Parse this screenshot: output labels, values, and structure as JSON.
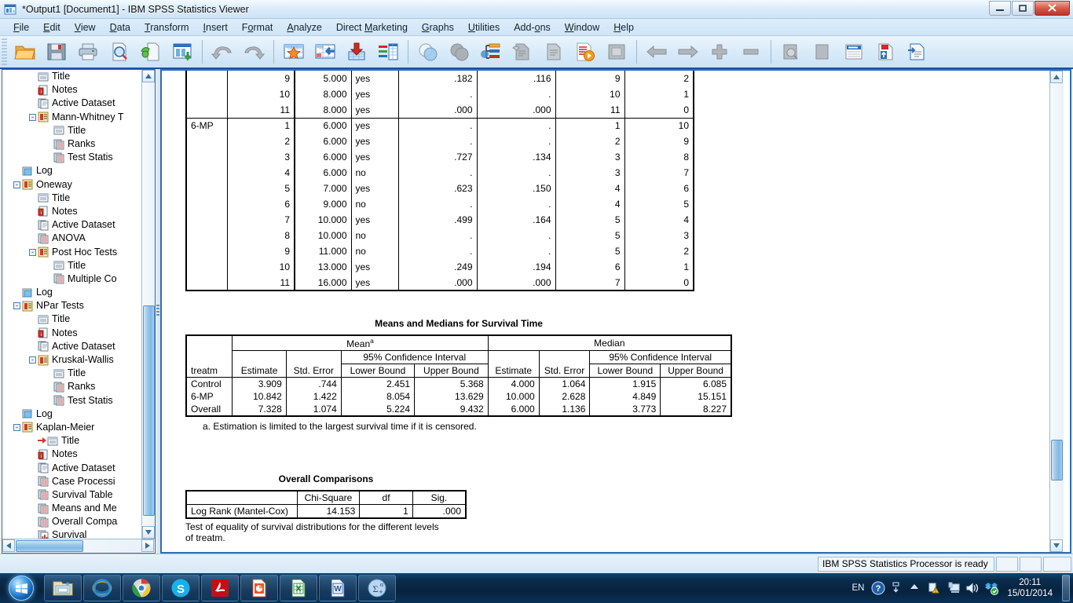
{
  "window": {
    "title": "*Output1 [Document1] - IBM SPSS Statistics Viewer",
    "minimize_label": "–",
    "maximize_label": "□",
    "close_label": "✕"
  },
  "menubar": {
    "items": [
      {
        "label": "File",
        "accel": "F"
      },
      {
        "label": "Edit",
        "accel": "E"
      },
      {
        "label": "View",
        "accel": "V"
      },
      {
        "label": "Data",
        "accel": "D"
      },
      {
        "label": "Transform",
        "accel": "T"
      },
      {
        "label": "Insert",
        "accel": "I"
      },
      {
        "label": "Format",
        "accel": "o"
      },
      {
        "label": "Analyze",
        "accel": "A"
      },
      {
        "label": "Direct Marketing",
        "accel": "M"
      },
      {
        "label": "Graphs",
        "accel": "G"
      },
      {
        "label": "Utilities",
        "accel": "U"
      },
      {
        "label": "Add-ons",
        "accel": "o"
      },
      {
        "label": "Window",
        "accel": "W"
      },
      {
        "label": "Help",
        "accel": "H"
      }
    ]
  },
  "toolbar": {
    "buttons": [
      {
        "name": "open-file-icon",
        "tooltip": "Open"
      },
      {
        "name": "save-icon",
        "tooltip": "Save"
      },
      {
        "name": "print-icon",
        "tooltip": "Print"
      },
      {
        "name": "print-preview-icon",
        "tooltip": "Print Preview"
      },
      {
        "name": "export-icon",
        "tooltip": "Export"
      },
      {
        "name": "dialog-recall-icon",
        "tooltip": "Recall recently used dialogs"
      },
      {
        "name": "undo-icon",
        "tooltip": "Undo"
      },
      {
        "name": "redo-icon",
        "tooltip": "Redo"
      },
      {
        "name": "goto-data-icon",
        "tooltip": "Go to data"
      },
      {
        "name": "goto-case-icon",
        "tooltip": "Go to case"
      },
      {
        "name": "insert-variable-icon",
        "tooltip": "Insert variable"
      },
      {
        "name": "split-file-icon",
        "tooltip": "Split file"
      },
      {
        "name": "weight-cases-icon",
        "tooltip": "Weight cases"
      },
      {
        "name": "select-cases-icon",
        "tooltip": "Select cases"
      },
      {
        "name": "value-labels-icon",
        "tooltip": "Value labels"
      },
      {
        "name": "use-variable-sets-icon",
        "tooltip": "Use variable sets"
      },
      {
        "name": "show-all-variables-icon",
        "tooltip": "Show all variables"
      },
      {
        "name": "spell-check-icon",
        "tooltip": "Spell check"
      },
      {
        "name": "run-icon",
        "tooltip": "Run"
      },
      {
        "name": "overlay-icon",
        "tooltip": "Overlay"
      },
      {
        "name": "previous-output-icon",
        "tooltip": "Previous output"
      },
      {
        "name": "next-output-icon",
        "tooltip": "Next output"
      },
      {
        "name": "promote-icon",
        "tooltip": "Promote"
      },
      {
        "name": "demote-icon",
        "tooltip": "Demote"
      },
      {
        "name": "preview-icon",
        "tooltip": "Preview"
      },
      {
        "name": "hide-icon",
        "tooltip": "Hide"
      },
      {
        "name": "insert-heading-icon",
        "tooltip": "Insert heading"
      },
      {
        "name": "insert-title-icon",
        "tooltip": "Insert title"
      },
      {
        "name": "insert-text-icon",
        "tooltip": "Insert text"
      }
    ]
  },
  "outline": {
    "items": [
      {
        "label": "Title",
        "icon": "title-icon",
        "depth": 3,
        "expander": ""
      },
      {
        "label": "Notes",
        "icon": "notes-icon",
        "depth": 3,
        "expander": ""
      },
      {
        "label": "Active Dataset",
        "icon": "dataset-icon",
        "depth": 3,
        "expander": ""
      },
      {
        "label": "Mann-Whitney T",
        "icon": "output-icon",
        "depth": 3,
        "expander": "-"
      },
      {
        "label": "Title",
        "icon": "title-icon",
        "depth": 4,
        "expander": ""
      },
      {
        "label": "Ranks",
        "icon": "table-icon",
        "depth": 4,
        "expander": ""
      },
      {
        "label": "Test Statis",
        "icon": "table-icon",
        "depth": 4,
        "expander": ""
      },
      {
        "label": "Log",
        "icon": "log-icon",
        "depth": 2,
        "expander": ""
      },
      {
        "label": "Oneway",
        "icon": "output-icon",
        "depth": 2,
        "expander": "-"
      },
      {
        "label": "Title",
        "icon": "title-icon",
        "depth": 3,
        "expander": ""
      },
      {
        "label": "Notes",
        "icon": "notes-icon",
        "depth": 3,
        "expander": ""
      },
      {
        "label": "Active Dataset",
        "icon": "dataset-icon",
        "depth": 3,
        "expander": ""
      },
      {
        "label": "ANOVA",
        "icon": "table-icon",
        "depth": 3,
        "expander": ""
      },
      {
        "label": "Post Hoc Tests",
        "icon": "output-icon",
        "depth": 3,
        "expander": "-"
      },
      {
        "label": "Title",
        "icon": "title-icon",
        "depth": 4,
        "expander": ""
      },
      {
        "label": "Multiple Co",
        "icon": "table-icon",
        "depth": 4,
        "expander": ""
      },
      {
        "label": "Log",
        "icon": "log-icon",
        "depth": 2,
        "expander": ""
      },
      {
        "label": "NPar Tests",
        "icon": "output-icon",
        "depth": 2,
        "expander": "-"
      },
      {
        "label": "Title",
        "icon": "title-icon",
        "depth": 3,
        "expander": ""
      },
      {
        "label": "Notes",
        "icon": "notes-icon",
        "depth": 3,
        "expander": ""
      },
      {
        "label": "Active Dataset",
        "icon": "dataset-icon",
        "depth": 3,
        "expander": ""
      },
      {
        "label": "Kruskal-Wallis",
        "icon": "output-icon",
        "depth": 3,
        "expander": "-"
      },
      {
        "label": "Title",
        "icon": "title-icon",
        "depth": 4,
        "expander": ""
      },
      {
        "label": "Ranks",
        "icon": "table-icon",
        "depth": 4,
        "expander": ""
      },
      {
        "label": "Test Statis",
        "icon": "table-icon",
        "depth": 4,
        "expander": ""
      },
      {
        "label": "Log",
        "icon": "log-icon",
        "depth": 2,
        "expander": ""
      },
      {
        "label": "Kaplan-Meier",
        "icon": "output-icon",
        "depth": 2,
        "expander": "-"
      },
      {
        "label": "Title",
        "icon": "title-icon",
        "depth": 3,
        "expander": "",
        "selected": true
      },
      {
        "label": "Notes",
        "icon": "notes-icon",
        "depth": 3,
        "expander": ""
      },
      {
        "label": "Active Dataset",
        "icon": "dataset-icon",
        "depth": 3,
        "expander": ""
      },
      {
        "label": "Case Processi",
        "icon": "table-icon",
        "depth": 3,
        "expander": ""
      },
      {
        "label": "Survival Table",
        "icon": "table-icon",
        "depth": 3,
        "expander": ""
      },
      {
        "label": "Means and Me",
        "icon": "table-icon",
        "depth": 3,
        "expander": ""
      },
      {
        "label": "Overall Compa",
        "icon": "table-icon",
        "depth": 3,
        "expander": ""
      },
      {
        "label": "Survival",
        "icon": "chart-icon",
        "depth": 3,
        "expander": ""
      }
    ]
  },
  "output": {
    "survival_table": {
      "rows": [
        {
          "group": "",
          "n": "9",
          "time": "5.000",
          "status": "yes",
          "surv": ".182",
          "se": ".116",
          "cum_events": "9",
          "n_remaining": "2"
        },
        {
          "group": "",
          "n": "10",
          "time": "8.000",
          "status": "yes",
          "surv": ".",
          "se": ".",
          "cum_events": "10",
          "n_remaining": "1"
        },
        {
          "group": "",
          "n": "11",
          "time": "8.000",
          "status": "yes",
          "surv": ".000",
          "se": ".000",
          "cum_events": "11",
          "n_remaining": "0"
        },
        {
          "group": "6-MP",
          "n": "1",
          "time": "6.000",
          "status": "yes",
          "surv": ".",
          "se": ".",
          "cum_events": "1",
          "n_remaining": "10",
          "group_start": true
        },
        {
          "group": "",
          "n": "2",
          "time": "6.000",
          "status": "yes",
          "surv": ".",
          "se": ".",
          "cum_events": "2",
          "n_remaining": "9"
        },
        {
          "group": "",
          "n": "3",
          "time": "6.000",
          "status": "yes",
          "surv": ".727",
          "se": ".134",
          "cum_events": "3",
          "n_remaining": "8"
        },
        {
          "group": "",
          "n": "4",
          "time": "6.000",
          "status": "no",
          "surv": ".",
          "se": ".",
          "cum_events": "3",
          "n_remaining": "7"
        },
        {
          "group": "",
          "n": "5",
          "time": "7.000",
          "status": "yes",
          "surv": ".623",
          "se": ".150",
          "cum_events": "4",
          "n_remaining": "6"
        },
        {
          "group": "",
          "n": "6",
          "time": "9.000",
          "status": "no",
          "surv": ".",
          "se": ".",
          "cum_events": "4",
          "n_remaining": "5"
        },
        {
          "group": "",
          "n": "7",
          "time": "10.000",
          "status": "yes",
          "surv": ".499",
          "se": ".164",
          "cum_events": "5",
          "n_remaining": "4"
        },
        {
          "group": "",
          "n": "8",
          "time": "10.000",
          "status": "no",
          "surv": ".",
          "se": ".",
          "cum_events": "5",
          "n_remaining": "3"
        },
        {
          "group": "",
          "n": "9",
          "time": "11.000",
          "status": "no",
          "surv": ".",
          "se": ".",
          "cum_events": "5",
          "n_remaining": "2"
        },
        {
          "group": "",
          "n": "10",
          "time": "13.000",
          "status": "yes",
          "surv": ".249",
          "se": ".194",
          "cum_events": "6",
          "n_remaining": "1"
        },
        {
          "group": "",
          "n": "11",
          "time": "16.000",
          "status": "yes",
          "surv": ".000",
          "se": ".000",
          "cum_events": "7",
          "n_remaining": "0"
        }
      ]
    },
    "means_medians": {
      "title": "Means and Medians for Survival Time",
      "header_mean": "Mean",
      "header_mean_sup": "a",
      "header_median": "Median",
      "header_ci": "95% Confidence Interval",
      "col_rowlabel": "treatm",
      "col_estimate": "Estimate",
      "col_stderr": "Std. Error",
      "col_lower": "Lower Bound",
      "col_upper": "Upper Bound",
      "rows": [
        {
          "label": "Control",
          "mean_est": "3.909",
          "mean_se": ".744",
          "mean_lo": "2.451",
          "mean_hi": "5.368",
          "med_est": "4.000",
          "med_se": "1.064",
          "med_lo": "1.915",
          "med_hi": "6.085"
        },
        {
          "label": "6-MP",
          "mean_est": "10.842",
          "mean_se": "1.422",
          "mean_lo": "8.054",
          "mean_hi": "13.629",
          "med_est": "10.000",
          "med_se": "2.628",
          "med_lo": "4.849",
          "med_hi": "15.151"
        },
        {
          "label": "Overall",
          "mean_est": "7.328",
          "mean_se": "1.074",
          "mean_lo": "5.224",
          "mean_hi": "9.432",
          "med_est": "6.000",
          "med_se": "1.136",
          "med_lo": "3.773",
          "med_hi": "8.227"
        }
      ],
      "footnote": "a. Estimation is limited to the largest survival time if it is censored."
    },
    "overall_comparisons": {
      "title": "Overall Comparisons",
      "col_blank": "",
      "col_chisq": "Chi-Square",
      "col_df": "df",
      "col_sig": "Sig.",
      "rows": [
        {
          "label": "Log Rank (Mantel-Cox)",
          "chisq": "14.153",
          "df": "1",
          "sig": ".000"
        }
      ],
      "note_line1": "Test of equality of survival distributions for the different levels",
      "note_line2": "of treatm."
    }
  },
  "statusbar": {
    "message": "IBM SPSS Statistics Processor is ready"
  },
  "taskbar": {
    "start_name": "start-orb",
    "buttons": [
      {
        "name": "windows-explorer-icon",
        "label": "Windows Explorer"
      },
      {
        "name": "internet-explorer-icon",
        "label": "Internet Explorer"
      },
      {
        "name": "google-chrome-icon",
        "label": "Google Chrome"
      },
      {
        "name": "skype-icon",
        "label": "Skype"
      },
      {
        "name": "adobe-reader-icon",
        "label": "Adobe Reader"
      },
      {
        "name": "powerpoint-icon",
        "label": "PowerPoint"
      },
      {
        "name": "excel-icon",
        "label": "Excel"
      },
      {
        "name": "word-icon",
        "label": "Word"
      },
      {
        "name": "spss-icon",
        "label": "IBM SPSS Statistics"
      }
    ],
    "tray": {
      "language": "EN",
      "time": "20:11",
      "date": "15/01/2014",
      "icons": [
        "help-icon",
        "action-center-icon",
        "show-hidden-icons-icon",
        "network-icon",
        "volume-icon",
        "dropbox-icon"
      ]
    }
  },
  "colors": {
    "accent_blue": "#1951a8",
    "pane_border": "#2f6fb5",
    "titlebar_text": "#111111",
    "taskbar_dark": "#0b2c4d"
  }
}
